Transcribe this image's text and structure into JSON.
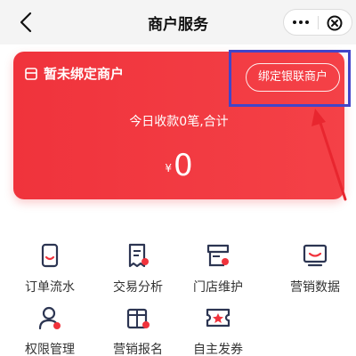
{
  "navbar": {
    "title": "商户服务"
  },
  "card": {
    "status": "暂未绑定商户",
    "bind_button": "绑定银联商户",
    "summary": "今日收款0笔,合计",
    "currency": "¥",
    "amount": "0"
  },
  "grid": {
    "items": [
      {
        "label": "订单流水",
        "icon": "order-icon"
      },
      {
        "label": "交易分析",
        "icon": "analysis-icon"
      },
      {
        "label": "门店维护",
        "icon": "store-icon"
      },
      {
        "label": "营销数据",
        "icon": "marketing-data-icon"
      },
      {
        "label": "权限管理",
        "icon": "permission-icon"
      },
      {
        "label": "营销报名",
        "icon": "marketing-signup-icon"
      },
      {
        "label": "自主发券",
        "icon": "coupon-icon"
      }
    ]
  },
  "colors": {
    "brand_red": "#f0333c",
    "icon_dark": "#2c3552",
    "highlight": "#4145c9"
  }
}
